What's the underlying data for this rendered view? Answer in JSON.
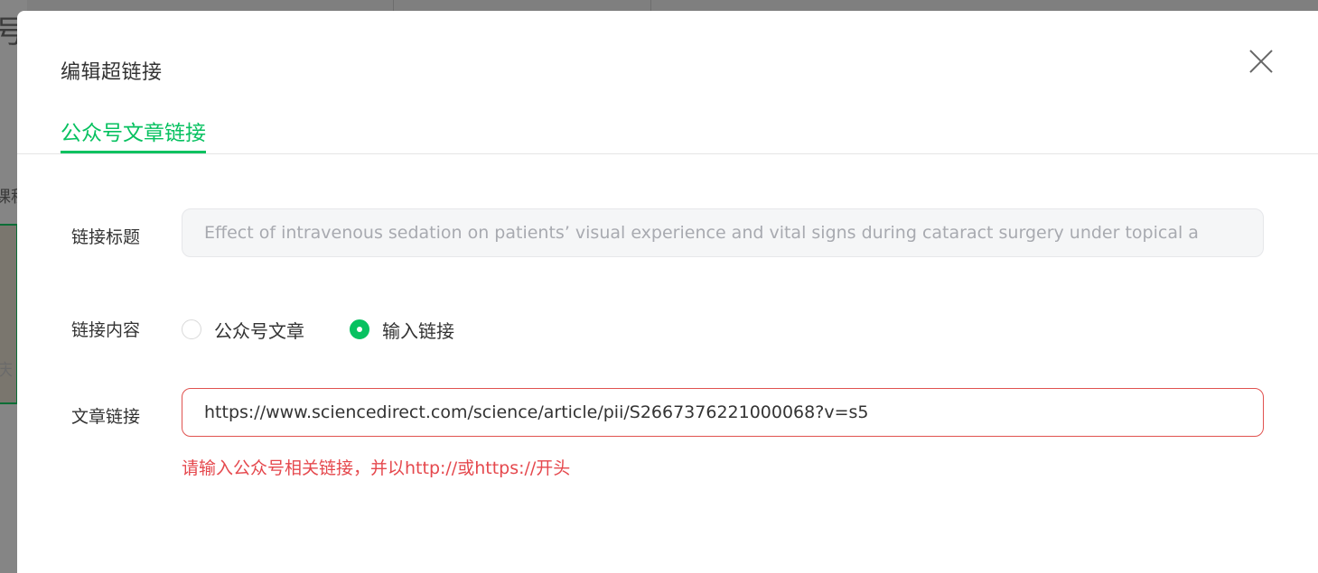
{
  "background": {
    "glyph_top": "号",
    "glyph_mid": "课程",
    "glyph_low": "庆"
  },
  "dialog": {
    "title": "编辑超链接",
    "close_icon": "close-icon",
    "tabs": [
      {
        "label": "公众号文章链接",
        "active": true
      }
    ],
    "form": {
      "title_label": "链接标题",
      "title_value": "Effect of intravenous sedation on patients’ visual experience and vital signs during cataract surgery under topical a",
      "content_label": "链接内容",
      "content_options": [
        {
          "label": "公众号文章",
          "checked": false
        },
        {
          "label": "输入链接",
          "checked": true
        }
      ],
      "link_label": "文章链接",
      "link_value": "https://www.sciencedirect.com/science/article/pii/S2667376221000068?v=s5",
      "error_message": "请输入公众号相关链接，并以http://或https://开头"
    }
  },
  "colors": {
    "accent": "#07c160",
    "error": "#e5484d",
    "overlay": "#7f7f7f"
  }
}
